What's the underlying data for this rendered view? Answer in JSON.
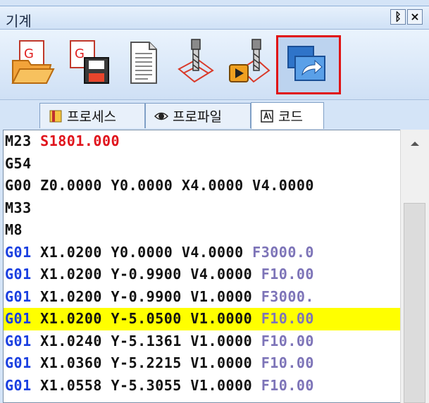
{
  "window": {
    "title": "기계",
    "pin_label": "ᛒ",
    "close_label": "×"
  },
  "toolbar": {
    "items": [
      {
        "name": "open-g-code",
        "icon": "folder-g-icon"
      },
      {
        "name": "save-g-code",
        "icon": "save-g-icon"
      },
      {
        "name": "document",
        "icon": "document-icon"
      },
      {
        "name": "toolpath",
        "icon": "toolpath-icon"
      },
      {
        "name": "run-simulation",
        "icon": "play-toolpath-icon"
      },
      {
        "name": "send-to-machine",
        "icon": "monitor-arrow-icon",
        "selected": true
      }
    ]
  },
  "tabs": [
    {
      "label": "프로세스",
      "icon": "process-icon",
      "active": false
    },
    {
      "label": "프로파일",
      "icon": "eye-icon",
      "active": false
    },
    {
      "label": "코드",
      "icon": "code-icon",
      "active": true
    }
  ],
  "code_lines": [
    {
      "segments": [
        {
          "t": "M23 ",
          "c": ""
        },
        {
          "t": "S1801.000",
          "c": "s"
        }
      ]
    },
    {
      "segments": [
        {
          "t": "G54",
          "c": ""
        }
      ]
    },
    {
      "segments": [
        {
          "t": "G00 Z0.0000 Y0.0000 X4.0000 V4.0000",
          "c": ""
        }
      ]
    },
    {
      "segments": [
        {
          "t": "M33",
          "c": ""
        }
      ]
    },
    {
      "segments": [
        {
          "t": "M8",
          "c": ""
        }
      ]
    },
    {
      "segments": [
        {
          "t": "G01",
          "c": "g"
        },
        {
          "t": " X1.0200 Y0.0000 V4.0000 ",
          "c": ""
        },
        {
          "t": "F3000.0",
          "c": "f"
        }
      ]
    },
    {
      "segments": [
        {
          "t": "G01",
          "c": "g"
        },
        {
          "t": " X1.0200 Y-0.9900 V4.0000 ",
          "c": ""
        },
        {
          "t": "F10.00",
          "c": "f"
        }
      ]
    },
    {
      "segments": [
        {
          "t": "G01",
          "c": "g"
        },
        {
          "t": " X1.0200 Y-0.9900 V1.0000 ",
          "c": ""
        },
        {
          "t": "F3000.",
          "c": "f"
        }
      ]
    },
    {
      "segments": [
        {
          "t": "G01",
          "c": "g"
        },
        {
          "t": " X1.0200 Y-5.0500 V1.0000 ",
          "c": ""
        },
        {
          "t": "F10.00",
          "c": "f"
        }
      ],
      "highlight": true
    },
    {
      "segments": [
        {
          "t": "G01",
          "c": "g"
        },
        {
          "t": " X1.0240 Y-5.1361 V1.0000 ",
          "c": ""
        },
        {
          "t": "F10.00",
          "c": "f"
        }
      ]
    },
    {
      "segments": [
        {
          "t": "G01",
          "c": "g"
        },
        {
          "t": " X1.0360 Y-5.2215 V1.0000 ",
          "c": ""
        },
        {
          "t": "F10.00",
          "c": "f"
        }
      ]
    },
    {
      "segments": [
        {
          "t": "G01",
          "c": "g"
        },
        {
          "t": " X1.0558 Y-5.3055 V1.0000 ",
          "c": ""
        },
        {
          "t": "F10.00",
          "c": "f"
        }
      ]
    }
  ],
  "colors": {
    "gcode": "#1a3fe0",
    "spindle": "#e0141c",
    "feed": "#7d74b8",
    "highlight": "#ffff00",
    "selected_border": "#e01313"
  }
}
